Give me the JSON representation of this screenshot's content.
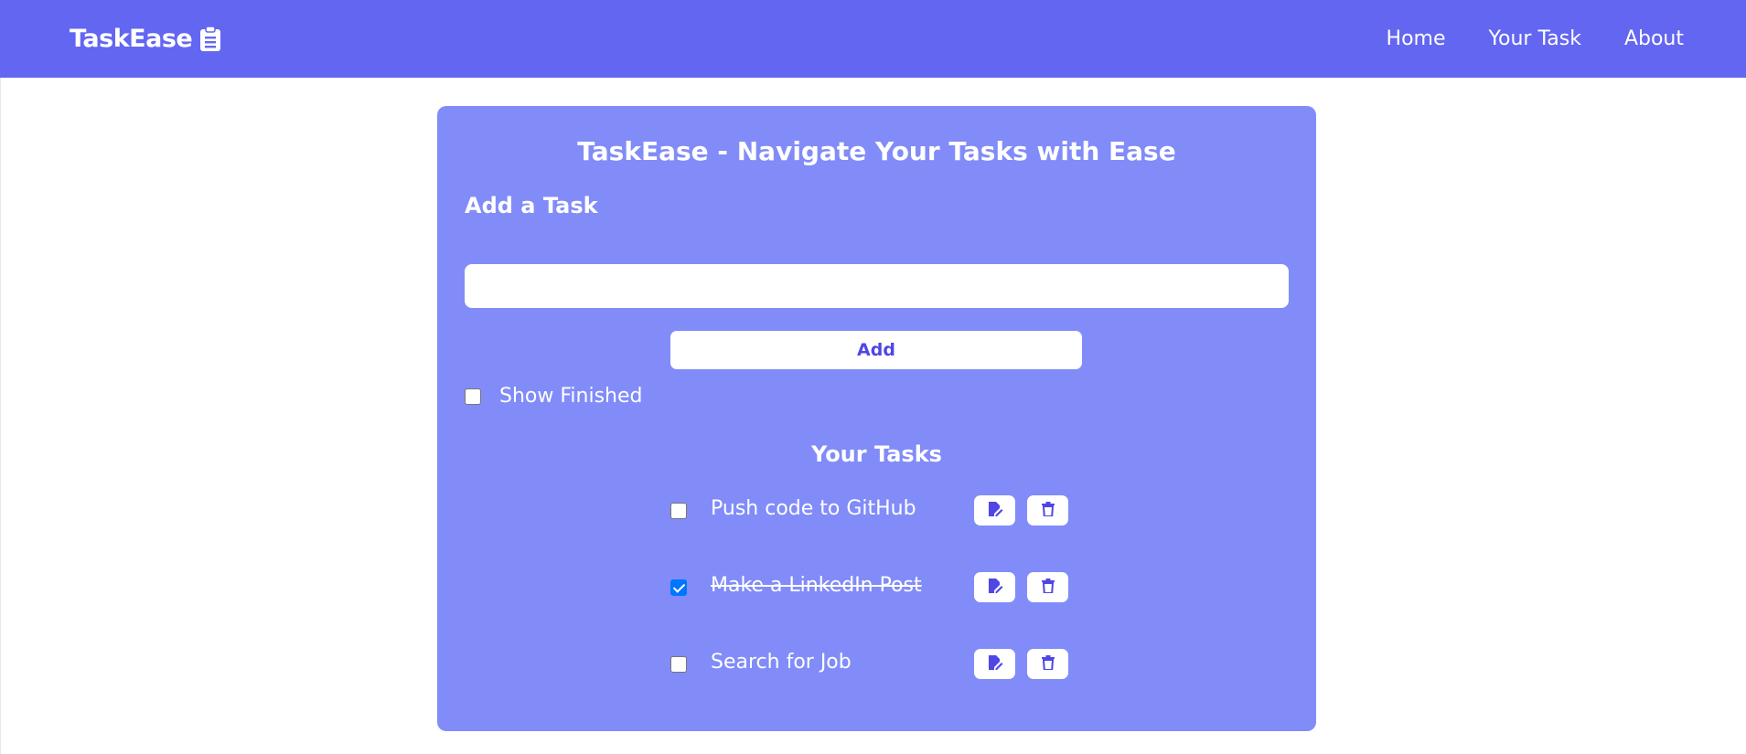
{
  "navbar": {
    "brand": "TaskEase",
    "links": [
      "Home",
      "Your Task",
      "About"
    ]
  },
  "card": {
    "title": "TaskEase - Navigate Your Tasks with Ease",
    "add_heading": "Add a Task",
    "input_value": "",
    "add_button": "Add",
    "show_finished_label": "Show Finished",
    "show_finished_checked": false,
    "tasks_heading": "Your Tasks",
    "tasks": [
      {
        "text": "Push code to GitHub",
        "done": false
      },
      {
        "text": "Make a LinkedIn Post",
        "done": true
      },
      {
        "text": "Search for Job",
        "done": false
      }
    ]
  },
  "colors": {
    "navbar": "#6366f1",
    "card": "#818cf8",
    "accent": "#4f46e5",
    "checkbox_checked": "#0075ff"
  },
  "icons": {
    "brand": "clipboard-icon",
    "edit": "edit-icon",
    "delete": "trash-icon"
  }
}
